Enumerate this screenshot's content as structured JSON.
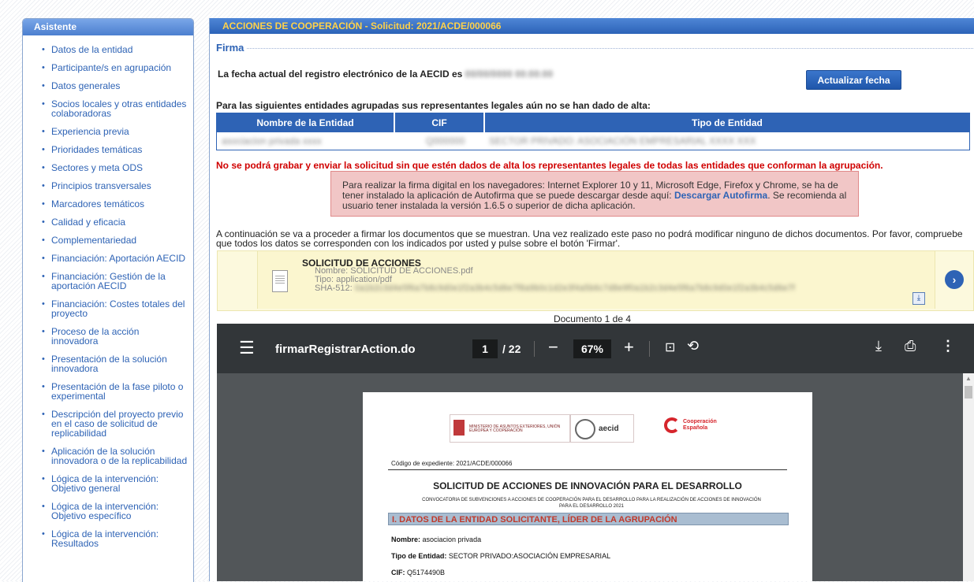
{
  "sidebar": {
    "title": "Asistente",
    "items": [
      "Datos de la entidad",
      "Participante/s en agrupación",
      "Datos generales",
      "Socios locales y otras entidades colaboradoras",
      "Experiencia previa",
      "Prioridades temáticas",
      "Sectores y meta ODS",
      "Principios transversales",
      "Marcadores temáticos",
      "Calidad y eficacia",
      "Complementariedad",
      "Financiación: Aportación AECID",
      "Financiación: Gestión de la aportación AECID",
      "Financiación: Costes totales del proyecto",
      "Proceso de la acción innovadora",
      "Presentación de la solución innovadora",
      "Presentación de la fase piloto o experimental",
      "Descripción del proyecto previo en el caso de solicitud de replicabilidad",
      "Aplicación de la solución innovadora o de la replicabilidad",
      "Lógica de la intervención: Objetivo general",
      "Lógica de la intervención: Objetivo específico",
      "Lógica de la intervención: Resultados"
    ]
  },
  "main": {
    "title": "ACCIONES DE COOPERACIÓN - Solicitud: 2021/ACDE/000066",
    "section": "Firma",
    "date_label": "La fecha actual del registro electrónico de la AECID es",
    "date_value": "",
    "update_button": "Actualizar fecha",
    "entities_intro": "Para las siguientes entidades agrupadas sus representantes legales aún no se han dado de alta:",
    "table": {
      "headers": [
        "Nombre de la Entidad",
        "CIF",
        "Tipo de Entidad"
      ]
    },
    "warning": "No se podrá grabar y enviar la solicitud sin que estén dados de alta los representantes legales de todas las entidades que conforman la agrupación.",
    "alert": {
      "text_before": "Para realizar la firma digital en los navegadores: Internet Explorer 10 y 11, Microsoft Edge, Firefox y Chrome, se ha de tener instalado la aplicación de Autofirma que se puede descargar desde aquí: ",
      "link": "Descargar Autofirma",
      "text_after": ". Se recomienda al usuario tener instalada la versión 1.6.5 o superior de dicha aplicación."
    },
    "sign_text": "A continuación se va a proceder a firmar los documentos que se muestran. Una vez realizado este paso no podrá modificar ninguno de dichos documentos. Por favor, compruebe que todos los datos se corresponden con los indicados por usted y pulse sobre el botón 'Firmar'.",
    "document": {
      "title": "SOLICITUD DE ACCIONES",
      "name": "Nombre: SOLICITUD DE ACCIONES.pdf",
      "type": "Tipo: application/pdf",
      "sha_label": "SHA-512:"
    },
    "doc_count": "Documento 1 de 4"
  },
  "pdf_viewer": {
    "filename": "firmarRegistrarAction.do",
    "page": "1",
    "total": "/ 22",
    "zoom": "67%",
    "icons": {
      "menu": "menu-icon",
      "minus": "zoom-out-icon",
      "plus": "zoom-in-icon",
      "fit": "fit-page-icon",
      "rotate": "rotate-icon",
      "download": "download-icon",
      "print": "print-icon",
      "more": "more-icon"
    }
  },
  "pdf_page": {
    "logo_ministry": "MINISTERIO DE ASUNTOS EXTERIORES, UNIÓN EUROPEA Y COOPERACIÓN",
    "logo_aecid": "aecid",
    "logo_coop": "Cooperación Española",
    "codigo": "Código de expediente: 2021/ACDE/000066",
    "heading": "SOLICITUD DE ACCIONES DE INNOVACIÓN PARA EL DESARROLLO",
    "convocatoria": "CONVOCATORIA DE SUBVENCIONES A ACCIONES DE COOPERACIÓN PARA EL DESARROLLO PARA LA REALIZACIÓN DE ACCIONES DE INNOVACIÓN PARA EL DESARROLLO 2021",
    "band": "I. DATOS DE LA ENTIDAD SOLICITANTE, LÍDER DE LA AGRUPACIÓN",
    "nombre_label": "Nombre:",
    "nombre_value": "asociacion privada",
    "tipo_label": "Tipo de Entidad:",
    "tipo_value": "SECTOR PRIVADO:ASOCIACIÓN EMPRESARIAL",
    "cif_label": "CIF:",
    "cif_value": "Q5174490B"
  },
  "colors": {
    "primary_blue": "#2e63b5",
    "header_yellow": "#ffd24a",
    "warning_red": "#d00000",
    "alert_bg": "#f1c6c6",
    "pdf_toolbar": "#323639"
  }
}
